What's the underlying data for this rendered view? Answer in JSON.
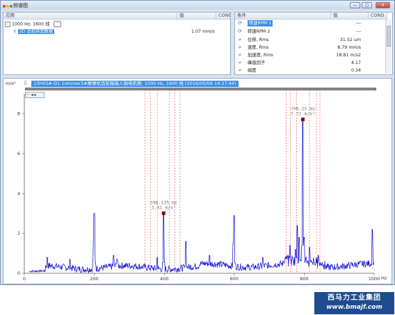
{
  "window": {
    "title": "频谱图",
    "buttons": [
      "—",
      "□",
      "✕"
    ]
  },
  "left_panel": {
    "col_application": "应用",
    "col_value": "值",
    "col_cond": "COND",
    "tree": [
      {
        "label": "1000 Hz, 1600 线",
        "value": ""
      },
      {
        "label": "2D 总和带宽数据",
        "value": "1.07 mm/s"
      }
    ]
  },
  "right_panel": {
    "col_condition": "条件",
    "col_value": "值",
    "col_cond": "COND",
    "rows": [
      {
        "icon": "rpm-icon",
        "label": "转速RPM 1",
        "value": "---",
        "selected": true
      },
      {
        "icon": "rpm-icon",
        "label": "转速RPM 2",
        "value": "---"
      },
      {
        "icon": "wave-icon",
        "label": "位移, Rms",
        "value": "31.52 um"
      },
      {
        "icon": "wave-icon",
        "label": "速度, Rms",
        "value": "8.79 mm/s"
      },
      {
        "icon": "wave-icon",
        "label": "加速度, Rms",
        "value": "18.81 m/s2"
      },
      {
        "icon": "wave-icon",
        "label": "峰值因子",
        "value": "4.17"
      },
      {
        "icon": "wave-icon",
        "label": "峭度",
        "value": "0.34"
      }
    ]
  },
  "chart_header": {
    "title": "13H03#-D1 1ommer3#摩擦机齿轮箱输入轴电机侧: 1000 Hz, 1600 线 (2016/05/06 14:27:44)",
    "nav_labels": "··· ◂ ▸"
  },
  "chart_data": {
    "type": "line",
    "ylabel": "m/s²",
    "xlabel": "Hz",
    "xlim": [
      0,
      1000
    ],
    "ylim": [
      0,
      9
    ],
    "x_ticks": [
      "0",
      "200",
      "400",
      "600",
      "800",
      "1000"
    ],
    "y_ticks": [
      "0",
      "2",
      "4",
      "6",
      "8"
    ],
    "series_color": "#0000d4",
    "peaks": [
      {
        "x": 65,
        "y": 0.8
      },
      {
        "x": 130,
        "y": 0.7
      },
      {
        "x": 198,
        "y": 1.5
      },
      {
        "x": 200,
        "y": 3.0
      },
      {
        "x": 255,
        "y": 0.9
      },
      {
        "x": 265,
        "y": 0.7
      },
      {
        "x": 380,
        "y": 0.8
      },
      {
        "x": 398.12,
        "y": 3.01
      },
      {
        "x": 462,
        "y": 1.6
      },
      {
        "x": 530,
        "y": 0.9
      },
      {
        "x": 597,
        "y": 1.5
      },
      {
        "x": 600,
        "y": 2.9
      },
      {
        "x": 682,
        "y": 0.8
      },
      {
        "x": 760,
        "y": 1.4
      },
      {
        "x": 775,
        "y": 1.2
      },
      {
        "x": 780,
        "y": 2.4
      },
      {
        "x": 785,
        "y": 1.8
      },
      {
        "x": 796.25,
        "y": 7.72
      },
      {
        "x": 800,
        "y": 1.8
      },
      {
        "x": 815,
        "y": 1.3
      },
      {
        "x": 840,
        "y": 0.9
      },
      {
        "x": 995,
        "y": 2.2
      }
    ],
    "harmonic_lines": [
      345,
      360,
      380,
      415,
      430,
      445,
      748,
      760,
      778,
      815,
      835,
      845
    ],
    "markers": [
      {
        "x": 398.12,
        "y": 3.01,
        "label1": "398.125 Hz",
        "label2": "3.01 m/s²"
      },
      {
        "x": 796.25,
        "y": 7.72,
        "label1": "796.25 Hz",
        "label2": "7.72 m/s²"
      }
    ]
  },
  "logo": {
    "line1": "西马力工业集团",
    "line2": "www.bmajf.com"
  }
}
